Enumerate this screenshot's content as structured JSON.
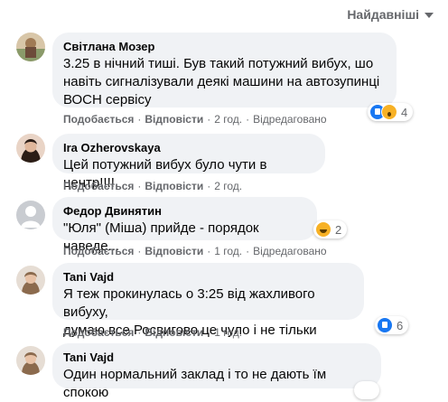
{
  "sort": {
    "label": "Найдавніші"
  },
  "actions": {
    "like": "Подобається",
    "reply": "Відповісти",
    "edited": "Відредаговано"
  },
  "comments": [
    {
      "author": "Світлана Мозер",
      "lines": [
        "3.25 в нічний тиші. Був такий потужний вибух, шо",
        "навіть сигналізували деякі машини на автозупинці",
        "ВОСН сервісу"
      ],
      "time": "2 год.",
      "edited": true,
      "reactions": {
        "icons": [
          "like-icon",
          "wow-icon"
        ],
        "count": "4"
      }
    },
    {
      "author": "Ira Ozherovskaya",
      "lines": [
        "Цей потужний вибух було чути в центр!!!!"
      ],
      "time": "2 год.",
      "edited": false,
      "reactions": null
    },
    {
      "author": "Федор Двинятин",
      "lines": [
        "\"Юля\" (Міша) прийде - порядок наведе..."
      ],
      "time": "1 год.",
      "edited": true,
      "reactions": {
        "icons": [
          "haha-icon"
        ],
        "count": "2"
      }
    },
    {
      "author": "Tani Vajd",
      "lines": [
        "Я теж прокинулась о 3:25 від жахливого вибуху,",
        "думаю все Росвигово це чуло і не тільки"
      ],
      "time": "1 год.",
      "edited": false,
      "reactions": {
        "icons": [
          "like-icon"
        ],
        "count": "6"
      }
    },
    {
      "author": "Tani Vajd",
      "lines": [
        "Один нормальний заклад і то не дають їм спокою"
      ],
      "time": "",
      "edited": false,
      "reactions": null
    }
  ]
}
